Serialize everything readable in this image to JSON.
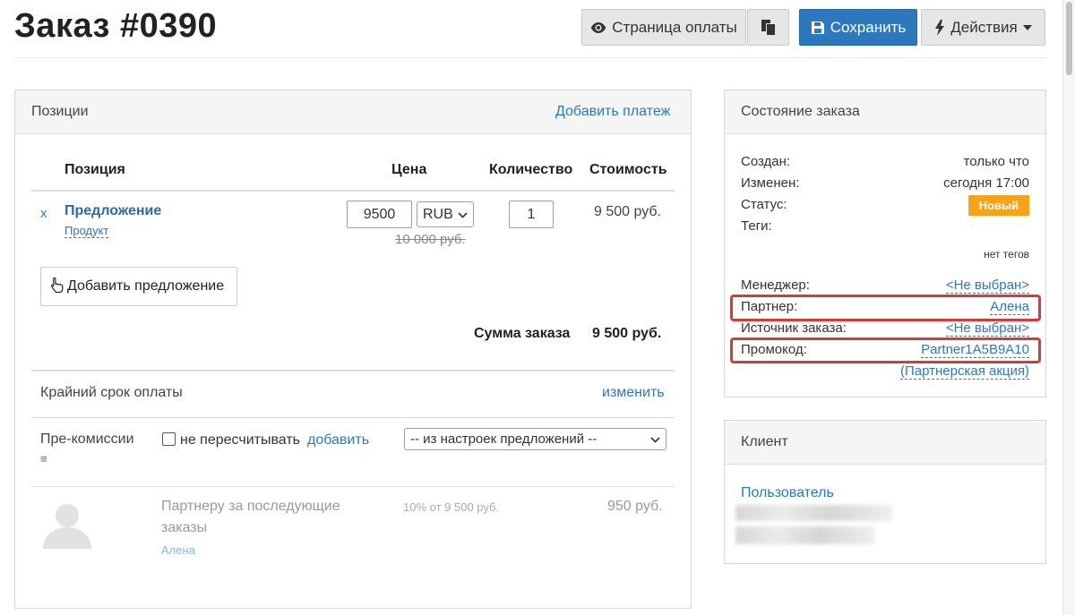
{
  "header": {
    "title": "Заказ #0390",
    "payment_page_label": "Страница оплаты",
    "save_label": "Сохранить",
    "actions_label": "Действия"
  },
  "positions": {
    "title": "Позиции",
    "add_payment_label": "Добавить платеж",
    "columns": [
      "Позиция",
      "Цена",
      "Количество",
      "Стоимость"
    ],
    "item": {
      "remove_label": "x",
      "name": "Предложение",
      "type": "Продукт",
      "price_value": "9500",
      "currency": "RUB",
      "old_price": "10 000 руб.",
      "quantity": "1",
      "cost": "9 500 руб."
    },
    "add_offer_label": "Добавить предложение",
    "total_label": "Сумма заказа",
    "total_value": "9 500 руб.",
    "deadline_label": "Крайний срок оплаты",
    "deadline_change_label": "изменить",
    "precommission_label": "Пре-комиссии",
    "precommission_sub": "≡",
    "no_recalc_label": "не пересчитывать",
    "add_label": "добавить",
    "commission_source": "-- из настроек предложений --",
    "commission_row": {
      "desc_line1": "Партнеру за последующие",
      "desc_line2": "заказы",
      "partner": "Алена",
      "percent": "10% от 9 500 руб.",
      "amount": "950 руб."
    }
  },
  "status": {
    "title": "Состояние заказа",
    "created_label": "Создан:",
    "created_value": "только что",
    "changed_label": "Изменен:",
    "changed_value": "сегодня 17:00",
    "status_label": "Статус:",
    "status_value": "Новый",
    "tags_label": "Теги:",
    "tags_value": "нет тегов",
    "manager_label": "Менеджер:",
    "manager_value": "<Не выбран>",
    "partner_label": "Партнер:",
    "partner_value": "Алена",
    "source_label": "Источник заказа:",
    "source_value": "<Не выбран>",
    "promo_label": "Промокод:",
    "promo_value": "Partner1A5B9A10",
    "promo_action": "(Партнерская акция)"
  },
  "client": {
    "title": "Клиент",
    "user_label": "Пользователь"
  },
  "colors": {
    "primary": "#2d78bd",
    "badge": "#f5a31a",
    "highlight": "#d43b3b"
  }
}
